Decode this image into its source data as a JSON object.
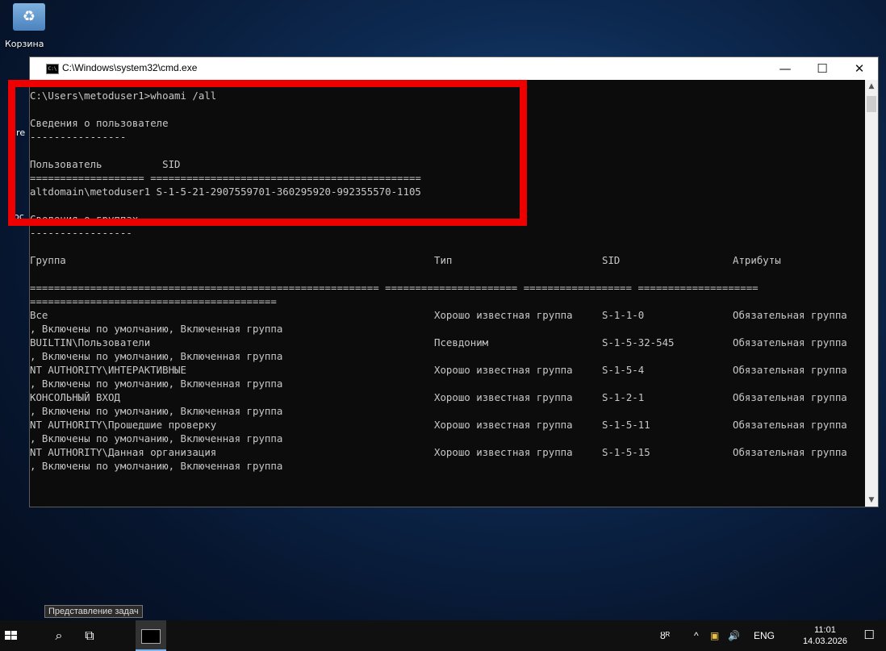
{
  "desktop": {
    "recycle_bin_label": "Корзина",
    "peek_labels": [
      "ire",
      "oc"
    ]
  },
  "window": {
    "title": "C:\\Windows\\system32\\cmd.exe",
    "icon": "cmd-icon",
    "minimize_glyph": "—",
    "maximize_glyph": "☐",
    "close_glyph": "✕"
  },
  "console": {
    "prompt_line": "C:\\Users\\metoduser1>whoami /all",
    "user_section_title": "Сведения о пользователе",
    "user_section_rule": "----------------",
    "user_header": "Пользователь          SID",
    "user_header_rule": "=================== =============================================",
    "user_row": "altdomain\\metoduser1 S-1-5-21-2907559701-360295920-992355570-1105",
    "groups_section_title": "Сведения о группах",
    "groups_section_rule": "-----------------",
    "groups_headers": [
      "Группа",
      "Тип",
      "SID",
      "Атрибуты"
    ],
    "groups_rule_1": "========================================================== ====================== ================== ====================",
    "groups_rule_2": "=========================================",
    "groups": [
      {
        "name": "Все",
        "type": "Хорошо известная группа",
        "sid": "S-1-1-0",
        "attr": "Обязательная группа",
        "cont": ", Включены по умолчанию, Включенная группа"
      },
      {
        "name": "BUILTIN\\Пользователи",
        "type": "Псевдоним",
        "sid": "S-1-5-32-545",
        "attr": "Обязательная группа",
        "cont": ", Включены по умолчанию, Включенная группа"
      },
      {
        "name": "NT AUTHORITY\\ИНТЕРАКТИВНЫЕ",
        "type": "Хорошо известная группа",
        "sid": "S-1-5-4",
        "attr": "Обязательная группа",
        "cont": ", Включены по умолчанию, Включенная группа"
      },
      {
        "name": "КОНСОЛЬНЫЙ ВХОД",
        "type": "Хорошо известная группа",
        "sid": "S-1-2-1",
        "attr": "Обязательная группа",
        "cont": ", Включены по умолчанию, Включенная группа"
      },
      {
        "name": "NT AUTHORITY\\Прошедшие проверку",
        "type": "Хорошо известная группа",
        "sid": "S-1-5-11",
        "attr": "Обязательная группа",
        "cont": ", Включены по умолчанию, Включенная группа"
      },
      {
        "name": "NT AUTHORITY\\Данная организация",
        "type": "Хорошо известная группа",
        "sid": "S-1-5-15",
        "attr": "Обязательная группа",
        "cont": ", Включены по умолчанию, Включенная группа"
      }
    ]
  },
  "highlight_color": "#ef0000",
  "taskbar": {
    "tooltip": "Представление задач",
    "tray_people": "ȣᴿ",
    "tray_chevron": "^",
    "tray_volume": "🔊",
    "language": "ENG",
    "time": "11:01",
    "date": "14.03.2026",
    "notification": "☐"
  }
}
